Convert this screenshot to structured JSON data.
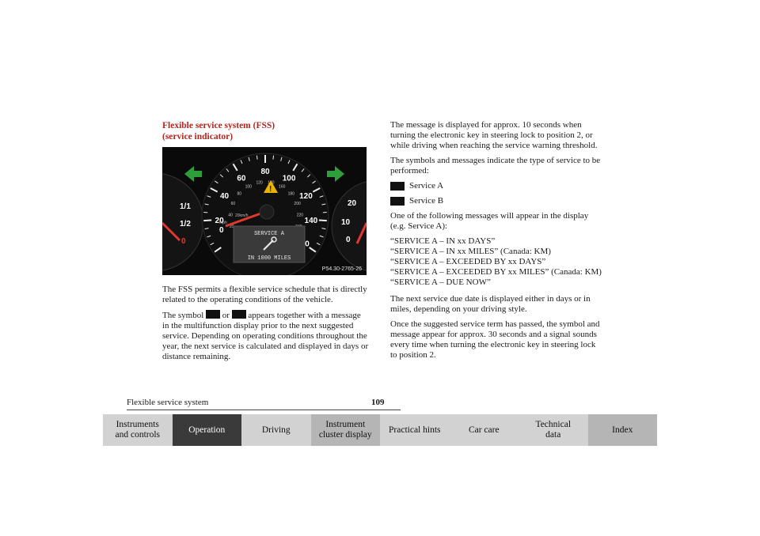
{
  "left": {
    "heading": "Flexible service system (FSS)\n(service indicator)",
    "figure": {
      "label": "P54.30-2765-26",
      "display_line1": "SERVICE A",
      "display_line2": "IN 1000 MILES",
      "speed_ticks_mph": [
        "20",
        "40",
        "60",
        "80",
        "100",
        "120",
        "140",
        "160"
      ],
      "speed_ticks_kmh": [
        "20",
        "40",
        "60",
        "80",
        "100",
        "120",
        "140",
        "160",
        "180",
        "200",
        "220",
        "240"
      ],
      "unit_kmh": "20km/h",
      "unit_mph": "mph",
      "zero": "0",
      "fuel_labels": [
        "1/1",
        "1/2",
        "0"
      ],
      "tacho_labels": [
        "20",
        "10",
        "0"
      ],
      "colors": {
        "arrow": "#2e9e3a",
        "needle": "#e03a2e",
        "warning": "#e8b400"
      }
    },
    "para1": "The FSS permits a flexible service schedule that is directly related to the operating conditions of the vehicle.",
    "para2_pre": "The symbol",
    "para2_or": "or",
    "para2_post": "appears together with a message in the multifunction display prior to the next suggested service. Depending on operating conditions throughout the year, the next service is calculated and displayed in days or distance remaining."
  },
  "right": {
    "para1": "The message is displayed for approx. 10 seconds when turning the electronic key in steering lock to position 2, or while driving when reaching the service warning threshold.",
    "para2": "The symbols and messages indicate the type of service to be performed:",
    "service_a": "Service A",
    "service_b": "Service B",
    "para3": "One of the following messages will appear in the display (e.g. Service A):",
    "messages": [
      "“SERVICE A – IN xx DAYS”",
      "“SERVICE A – IN xx MILES” (Canada: KM)",
      "“SERVICE A – EXCEEDED BY xx DAYS”",
      "“SERVICE A – EXCEEDED BY xx MILES” (Canada: KM)",
      "“SERVICE A – DUE NOW”"
    ],
    "para4": "The next service due date is displayed either in days or in miles, depending on your driving style.",
    "para5": "Once the suggested service term has passed, the symbol and message appear for approx. 30 seconds and a signal sounds every time when turning the electronic key in steering lock to position 2."
  },
  "footer": {
    "section": "Flexible service system",
    "page": "109"
  },
  "nav": [
    {
      "label": "Instruments\nand controls",
      "style": "light"
    },
    {
      "label": "Operation",
      "style": "dark"
    },
    {
      "label": "Driving",
      "style": "light"
    },
    {
      "label": "Instrument\ncluster display",
      "style": "mid"
    },
    {
      "label": "Practical hints",
      "style": "light"
    },
    {
      "label": "Car care",
      "style": "light"
    },
    {
      "label": "Technical\ndata",
      "style": "light"
    },
    {
      "label": "Index",
      "style": "mid"
    }
  ]
}
